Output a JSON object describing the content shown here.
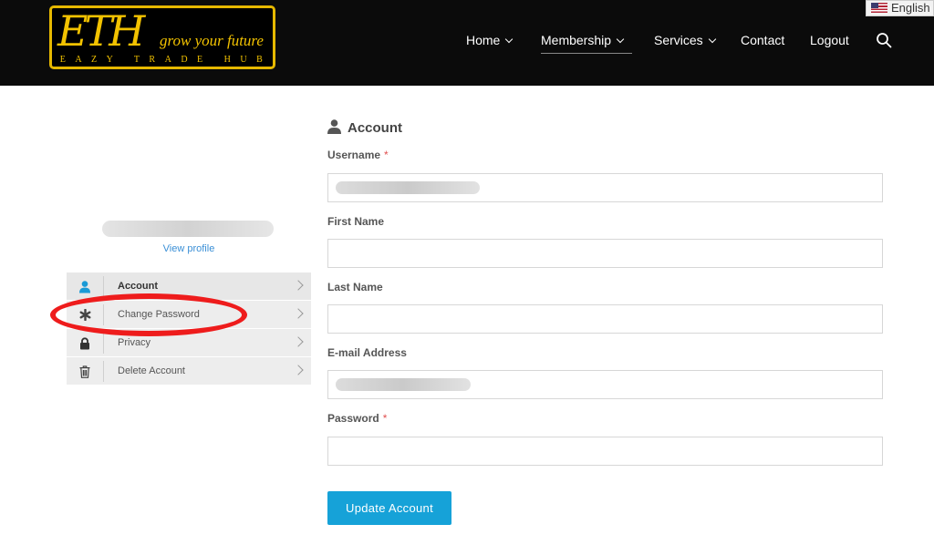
{
  "header": {
    "logo": {
      "mark": "ETH",
      "tagline": "grow your future",
      "subtitle": "EAZY TRADE HUB"
    },
    "nav": [
      {
        "label": "Home",
        "has_dropdown": true
      },
      {
        "label": "Membership",
        "has_dropdown": true,
        "active": true
      },
      {
        "label": "Services",
        "has_dropdown": true
      },
      {
        "label": "Contact",
        "has_dropdown": false
      },
      {
        "label": "Logout",
        "has_dropdown": false
      }
    ],
    "search_icon": "search-icon",
    "language": "English"
  },
  "sidebar": {
    "profile_name": "",
    "view_profile": "View profile",
    "menu": [
      {
        "label": "Account",
        "icon": "user-icon",
        "active": true
      },
      {
        "label": "Change Password",
        "icon": "asterisk-icon"
      },
      {
        "label": "Privacy",
        "icon": "lock-icon"
      },
      {
        "label": "Delete Account",
        "icon": "trash-icon"
      }
    ]
  },
  "form": {
    "title": "Account",
    "fields": {
      "username": {
        "label": "Username",
        "required": "*",
        "value": ""
      },
      "first_name": {
        "label": "First Name",
        "value": ""
      },
      "last_name": {
        "label": "Last Name",
        "value": ""
      },
      "email": {
        "label": "E-mail Address",
        "value": ""
      },
      "password": {
        "label": "Password",
        "required": "*",
        "value": ""
      }
    },
    "submit": "Update Account"
  },
  "colors": {
    "header_bg": "#0b0b0b",
    "logo_gold": "#f2c200",
    "link_blue": "#3a8fd6",
    "button_blue": "#16a2d8",
    "annotation_red": "#ee1c1c",
    "required_red": "#e05050"
  }
}
